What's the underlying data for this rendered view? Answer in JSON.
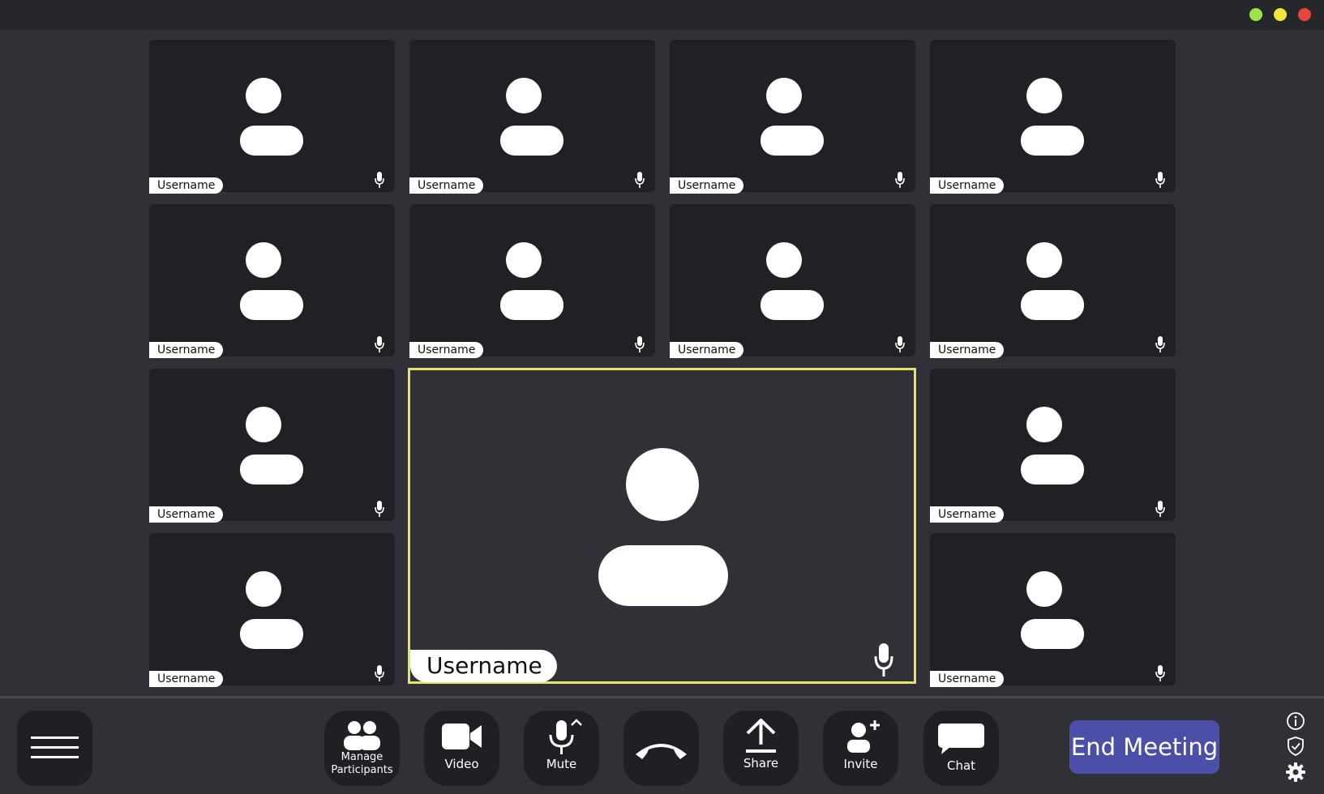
{
  "window": {
    "traffic_lights": [
      {
        "name": "green",
        "color": "#9ee24a"
      },
      {
        "name": "yellow",
        "color": "#f1e53b"
      },
      {
        "name": "red",
        "color": "#e8453c"
      }
    ]
  },
  "participants": [
    {
      "name": "Username"
    },
    {
      "name": "Username"
    },
    {
      "name": "Username"
    },
    {
      "name": "Username"
    },
    {
      "name": "Username"
    },
    {
      "name": "Username"
    },
    {
      "name": "Username"
    },
    {
      "name": "Username"
    },
    {
      "name": "Username"
    },
    {
      "name": "Username"
    },
    {
      "name": "Username"
    },
    {
      "name": "Username"
    }
  ],
  "active_speaker": {
    "name": "Username",
    "highlight_color": "#e8e26a"
  },
  "toolbar": {
    "menu_icon": "hamburger-icon",
    "manage_participants_label": "Manage\nParticipants",
    "video_label": "Video",
    "mute_label": "Mute",
    "share_label": "Share",
    "invite_label": "Invite",
    "chat_label": "Chat",
    "end_meeting_label": "End Meeting",
    "end_meeting_color": "#4b4fa8",
    "side_icons": [
      "info-icon",
      "shield-icon",
      "gear-icon"
    ]
  }
}
